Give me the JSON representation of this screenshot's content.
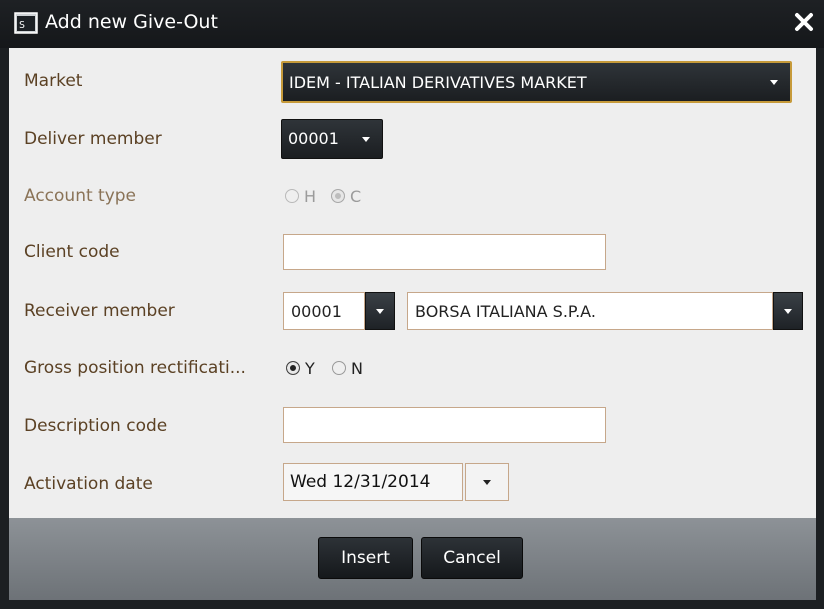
{
  "dialog": {
    "title": "Add new Give-Out",
    "close_icon": "close-icon",
    "window_icon": "terminal-window-icon"
  },
  "form": {
    "market": {
      "label": "Market",
      "value": "IDEM - ITALIAN DERIVATIVES MARKET"
    },
    "deliver_member": {
      "label": "Deliver member",
      "value": "00001"
    },
    "account_type": {
      "label": "Account type",
      "options": [
        "H",
        "C"
      ],
      "selected": "C",
      "disabled": true
    },
    "client_code": {
      "label": "Client code",
      "value": ""
    },
    "receiver_member": {
      "label": "Receiver member",
      "code": "00001",
      "name": "BORSA ITALIANA S.P.A."
    },
    "gross_position": {
      "label": "Gross position rectificati...",
      "options": [
        "Y",
        "N"
      ],
      "selected": "Y"
    },
    "description_code": {
      "label": "Description code",
      "value": ""
    },
    "activation_date": {
      "label": "Activation date",
      "value": "Wed 12/31/2014"
    }
  },
  "footer": {
    "insert_label": "Insert",
    "cancel_label": "Cancel"
  },
  "colors": {
    "label": "#5b4124",
    "dark_control": "#1b1e21",
    "accent_border": "#c69a3a"
  }
}
